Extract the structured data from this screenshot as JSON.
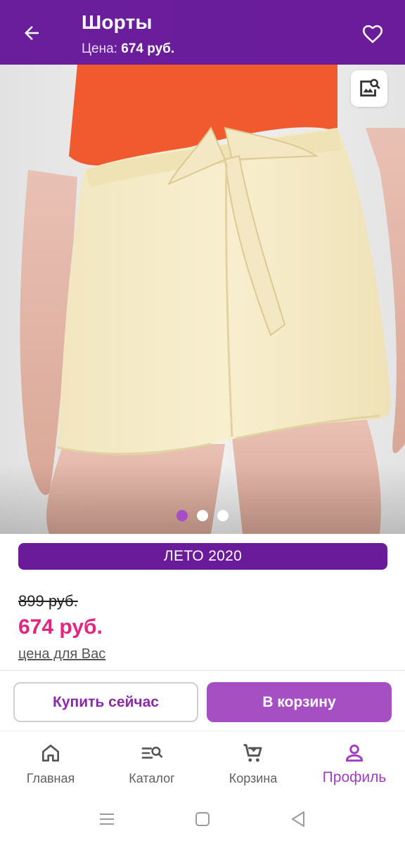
{
  "header": {
    "title": "Шорты",
    "price_label": "Цена:",
    "price_value": "674 руб."
  },
  "gallery": {
    "slide_count": 3,
    "active_slide": 1
  },
  "collection_label": "ЛЕТО 2020",
  "prices": {
    "old": "899 руб.",
    "current": "674 руб.",
    "note": "цена для Вас"
  },
  "actions": {
    "buy_now": "Купить сейчас",
    "add_to_cart": "В корзину"
  },
  "bottom_nav": {
    "items": [
      {
        "label": "Главная",
        "icon": "home-icon",
        "active": false
      },
      {
        "label": "Каталог",
        "icon": "catalog-search-icon",
        "active": false
      },
      {
        "label": "Корзина",
        "icon": "cart-icon",
        "active": false
      },
      {
        "label": "Профиль",
        "icon": "profile-icon",
        "active": true
      }
    ]
  },
  "colors": {
    "brand_purple": "#6a1b9a",
    "accent_purple": "#a64fc3",
    "price_pink": "#e4257f"
  }
}
